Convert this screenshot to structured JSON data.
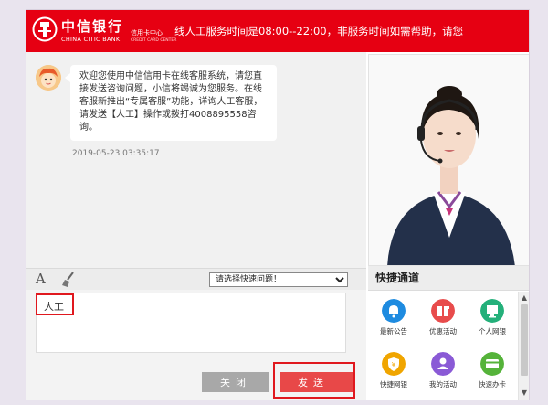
{
  "header": {
    "logo_cn": "中信银行",
    "logo_en": "CHINA CITIC BANK",
    "logo_sub": "信用卡中心",
    "logo_subsmall": "CREDIT CARD CENTER",
    "notice": "线人工服务时间是08:00--22:00，非服务时间如需帮助，请您"
  },
  "chat": {
    "message": "欢迎您使用中信信用卡在线客服系统，请您直接发送咨询问题，小信将竭诚为您服务。在线客服新推出“专属客服”功能，详询人工客服，请发送【人工】操作或拨打4008895558咨询。",
    "time": "2019-05-23 03:35:17"
  },
  "toolbar": {
    "font_icon": "A",
    "select_placeholder": "请选择快速问题！"
  },
  "input": {
    "value": "人工"
  },
  "buttons": {
    "close": "关闭",
    "send": "发送"
  },
  "quick": {
    "title": "快捷通道",
    "items": [
      {
        "label": "最新公告",
        "icon": "bell-icon",
        "color": "#1e8be0"
      },
      {
        "label": "优惠活动",
        "icon": "gift-icon",
        "color": "#e84c4c"
      },
      {
        "label": "个人网银",
        "icon": "monitor-icon",
        "color": "#24b07a"
      },
      {
        "label": "快捷网银",
        "icon": "shield-icon",
        "color": "#f0a500"
      },
      {
        "label": "我的活动",
        "icon": "user-icon",
        "color": "#8a5ad6"
      },
      {
        "label": "快速办卡",
        "icon": "card-icon",
        "color": "#55b33a"
      }
    ]
  },
  "colors": {
    "brand": "#e60012",
    "send": "#e84848",
    "highlight": "#e0181e"
  }
}
